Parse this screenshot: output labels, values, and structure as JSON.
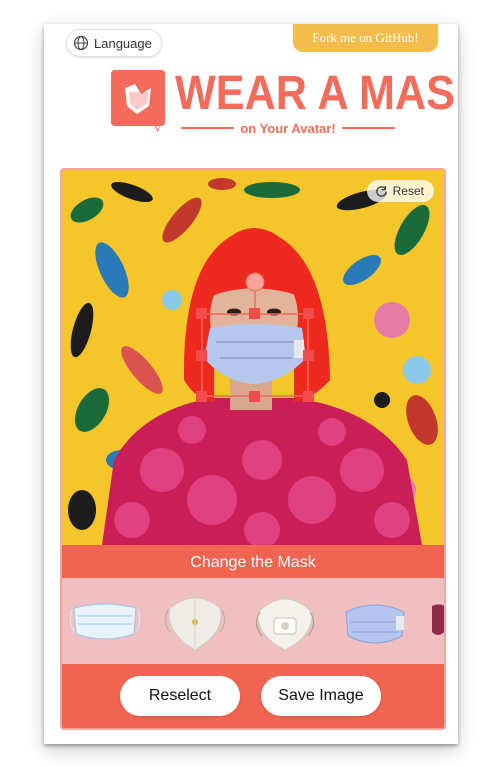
{
  "header": {
    "language_label": "Language",
    "fork_label": "Fork me on GitHub!",
    "logo_title": "WEAR A MASK",
    "logo_subtitle": "on Your Avatar!",
    "logo_letter": "V"
  },
  "editor": {
    "reset_label": "Reset",
    "change_mask_title": "Change the Mask",
    "masks": [
      "surgical-mask",
      "n95-mask-white",
      "3m-respirator-mask",
      "blue-kn95-mask",
      "partial-mask"
    ],
    "reselect_label": "Reselect",
    "save_label": "Save Image"
  },
  "colors": {
    "brand": "#f26b5b",
    "fork": "#f2bd4b",
    "strip": "#f0bfc1"
  }
}
